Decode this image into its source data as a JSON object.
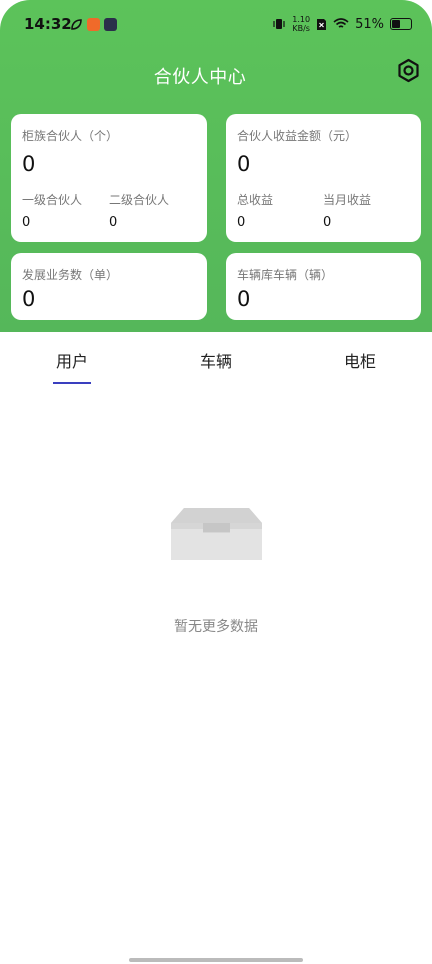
{
  "status_bar": {
    "time": "14:32",
    "net_speed_value": "1.10",
    "net_speed_unit": "KB/s",
    "battery": "51%"
  },
  "header": {
    "title": "合伙人中心",
    "settings_icon": "gear-icon"
  },
  "cards": {
    "cabinet_partners": {
      "label": "柜族合伙人（个）",
      "value": "0",
      "level1_label": "一级合伙人",
      "level1_value": "0",
      "level2_label": "二级合伙人",
      "level2_value": "0"
    },
    "partner_income": {
      "label": "合伙人收益金额（元）",
      "value": "0",
      "total_label": "总收益",
      "total_value": "0",
      "month_label": "当月收益",
      "month_value": "0"
    },
    "business": {
      "label": "发展业务数（单）",
      "value": "0"
    },
    "vehicles": {
      "label": "车辆库车辆（辆）",
      "value": "0"
    }
  },
  "tabs": [
    {
      "label": "用户",
      "active": true
    },
    {
      "label": "车辆",
      "active": false
    },
    {
      "label": "电柜",
      "active": false
    }
  ],
  "empty_state": {
    "icon": "empty-box-icon",
    "text": "暂无更多数据"
  },
  "colors": {
    "header_green": "#5cc35a",
    "tab_underline": "#3a3fbf"
  }
}
